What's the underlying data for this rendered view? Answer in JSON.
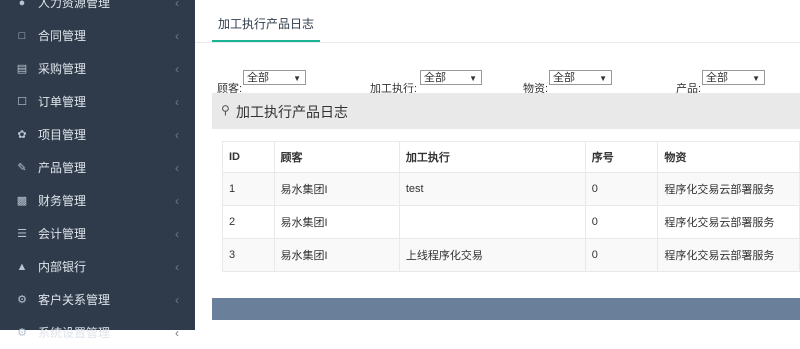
{
  "sidebar": {
    "items": [
      {
        "label": "人力资源管理",
        "icon": "people-icon"
      },
      {
        "label": "合同管理",
        "icon": "document-icon"
      },
      {
        "label": "采购管理",
        "icon": "list-icon"
      },
      {
        "label": "订单管理",
        "icon": "cart-icon"
      },
      {
        "label": "项目管理",
        "icon": "project-icon"
      },
      {
        "label": "产品管理",
        "icon": "edit-icon"
      },
      {
        "label": "财务管理",
        "icon": "money-icon"
      },
      {
        "label": "会计管理",
        "icon": "calculator-icon"
      },
      {
        "label": "内部银行",
        "icon": "bank-icon"
      },
      {
        "label": "客户关系管理",
        "icon": "gears-icon"
      },
      {
        "label": "系统设置管理",
        "icon": "settings-icon"
      }
    ]
  },
  "tab": {
    "label": "加工执行产品日志"
  },
  "filters": [
    {
      "label": "顾客:",
      "value": "全部"
    },
    {
      "label": "加工执行:",
      "value": "全部"
    },
    {
      "label": "物资:",
      "value": "全部"
    },
    {
      "label": "产品:",
      "value": "全部"
    }
  ],
  "panel": {
    "title": "加工执行产品日志",
    "icon": "user-icon"
  },
  "table": {
    "headers": [
      "ID",
      "顾客",
      "加工执行",
      "序号",
      "物资"
    ],
    "rows": [
      [
        "1",
        "易水集团I",
        "test",
        "0",
        "程序化交易云部署服务"
      ],
      [
        "2",
        "易水集团I",
        "",
        "0",
        "程序化交易云部署服务"
      ],
      [
        "3",
        "易水集团I",
        "上线程序化交易",
        "0",
        "程序化交易云部署服务"
      ]
    ]
  },
  "colors": {
    "sidebar": "#2f3b4a",
    "accent": "#1ab394",
    "panel_head": "#e9e9e9",
    "footer": "#6a7f99"
  }
}
